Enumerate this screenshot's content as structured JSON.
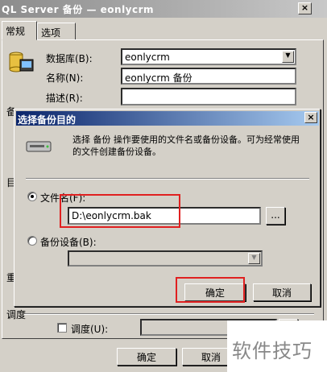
{
  "window": {
    "title": "QL Server 备份 — eonlycrm",
    "close_glyph": "×"
  },
  "tabs": [
    {
      "label": "常规"
    },
    {
      "label": "选项"
    }
  ],
  "general": {
    "database_label": "数据库(B):",
    "database_value": "eonlycrm",
    "name_label": "名称(N):",
    "name_value": "eonlycrm 备份",
    "desc_label": "描述(R):",
    "desc_value": "",
    "partial_label_backup": "备",
    "partial_label_dest": "目",
    "partial_label_overwrite": "重",
    "schedule_section": "调度",
    "schedule_checkbox_label": "调度(U):",
    "ok_label": "确定",
    "cancel_label": "取消"
  },
  "dialog": {
    "title": "选择备份目的",
    "close_glyph": "×",
    "description": "选择 备份 操作要使用的文件名或备份设备。可为经常使用的文件创建备份设备。",
    "filename_label": "文件名(F):",
    "filename_value": "D:\\eonlycrm.bak",
    "browse_label": "...",
    "device_label": "备份设备(B):",
    "device_value": "",
    "ok_label": "确定",
    "cancel_label": "取消",
    "selected_option": "filename",
    "highlight_color": "#e02020"
  },
  "watermark": {
    "text": "软件技巧"
  }
}
